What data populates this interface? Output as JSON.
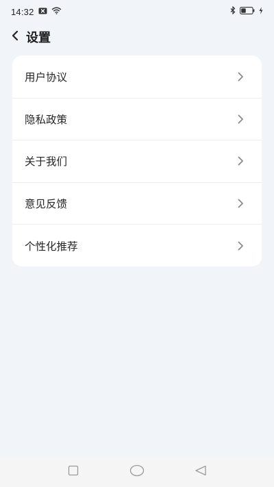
{
  "status_bar": {
    "time": "14:32",
    "icons": [
      "mail-x-icon",
      "wifi-icon",
      "bluetooth-icon",
      "battery-icon",
      "charging-bolt-icon"
    ],
    "battery_percent": 40
  },
  "header": {
    "title": "设置",
    "back_icon": "chevron-left-icon"
  },
  "settings": {
    "items": [
      {
        "label": "用户协议"
      },
      {
        "label": "隐私政策"
      },
      {
        "label": "关于我们"
      },
      {
        "label": "意见反馈"
      },
      {
        "label": "个性化推荐"
      }
    ],
    "chevron_icon": "chevron-right-icon"
  },
  "nav_bar": {
    "icons": [
      "square-recents-icon",
      "circle-home-icon",
      "triangle-back-icon"
    ]
  },
  "colors": {
    "background": "#f1f4f8",
    "card": "#ffffff",
    "text": "#262626",
    "chevron": "#8a8a8a"
  }
}
